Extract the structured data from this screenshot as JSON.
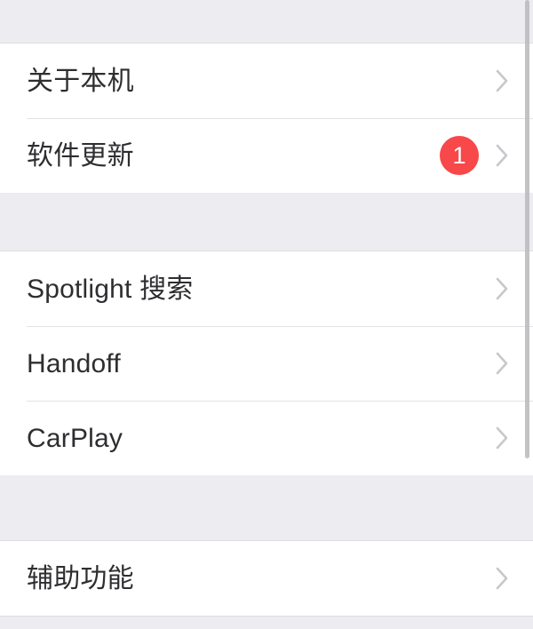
{
  "screen": {
    "name": "ios-settings-general",
    "background_color": "#edecf1",
    "row_background_color": "#ffffff",
    "separator_color": "#e3e2e6",
    "label_color": "#2e2e31",
    "chevron_color": "#c8c7cc",
    "badge_color": "#f8484a",
    "scrollbar_color": "#b9b8bd"
  },
  "sections": [
    {
      "id": "device-section",
      "rows": [
        {
          "name": "about-this-device",
          "label": "关于本机",
          "badge": null,
          "chevron": "chevron-right-icon"
        },
        {
          "name": "software-update",
          "label": "软件更新",
          "badge": "1",
          "chevron": "chevron-right-icon"
        }
      ]
    },
    {
      "id": "features-section",
      "rows": [
        {
          "name": "spotlight-search",
          "label": "Spotlight 搜索",
          "badge": null,
          "chevron": "chevron-right-icon"
        },
        {
          "name": "handoff",
          "label": "Handoff",
          "badge": null,
          "chevron": "chevron-right-icon"
        },
        {
          "name": "carplay",
          "label": "CarPlay",
          "badge": null,
          "chevron": "chevron-right-icon"
        }
      ]
    },
    {
      "id": "accessibility-section",
      "rows": [
        {
          "name": "accessibility",
          "label": "辅助功能",
          "badge": null,
          "chevron": "chevron-right-icon"
        }
      ]
    }
  ]
}
